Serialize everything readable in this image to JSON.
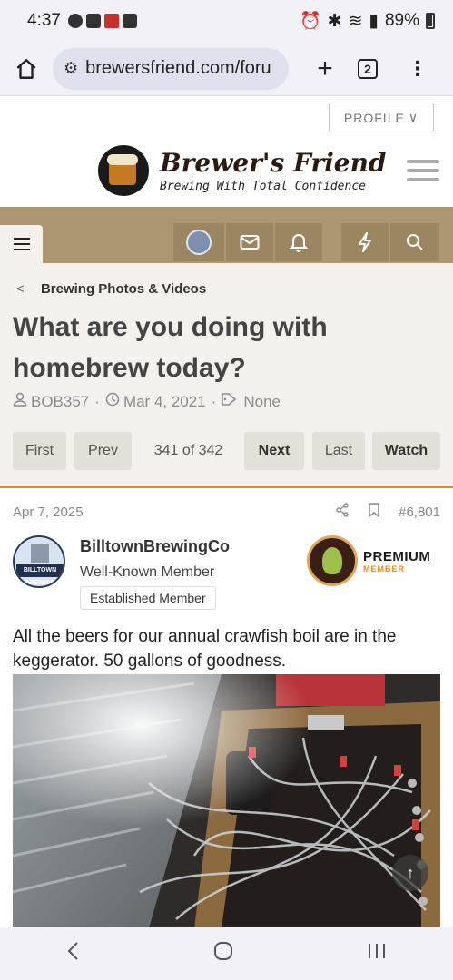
{
  "status_bar": {
    "time": "4:37",
    "battery": "89%"
  },
  "browser": {
    "url": "brewersfriend.com/foru",
    "tab_count": "2",
    "plus": "+",
    "menu": "⋮"
  },
  "site": {
    "profile_label": "PROFILE",
    "logo_title": "Brewer's Friend",
    "logo_tagline": "Brewing With Total Confidence"
  },
  "thread": {
    "breadcrumb": "Brewing Photos & Videos",
    "title": "What are you doing with homebrew today?",
    "author": "BOB357",
    "date": "Mar 4, 2021",
    "tags": "None"
  },
  "pager": {
    "first": "First",
    "prev": "Prev",
    "info": "341 of 342",
    "next": "Next",
    "last": "Last",
    "watch": "Watch"
  },
  "post": {
    "date": "Apr 7, 2025",
    "number": "#6,801",
    "username": "BilltownBrewingCo",
    "user_title": "Well-Known Member",
    "user_banner": "Established Member",
    "avatar_text": "BILLTOWN BREWING",
    "premium_title": "PREMIUM",
    "premium_sub": "MEMBER",
    "text": "All the beers for our annual crawfish boil are in the keggerator. 50 gallons of goodness."
  }
}
